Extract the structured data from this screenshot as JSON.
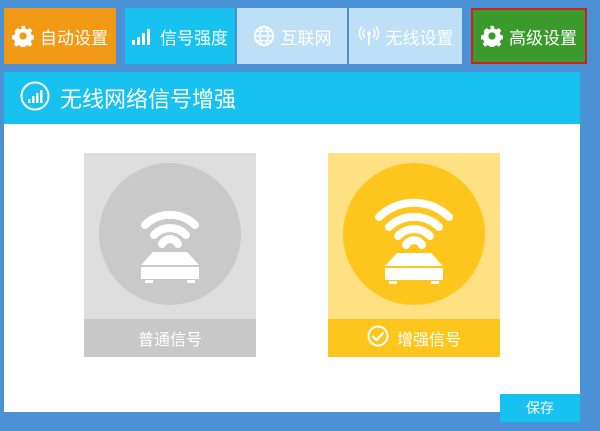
{
  "nav": {
    "tabs": [
      {
        "label": "自动设置",
        "icon": "gear-icon"
      },
      {
        "label": "信号强度",
        "icon": "signal-bars-icon"
      },
      {
        "label": "互联网",
        "icon": "globe-icon"
      },
      {
        "label": "无线设置",
        "icon": "antenna-icon"
      },
      {
        "label": "高级设置",
        "icon": "gear-icon"
      }
    ]
  },
  "panel": {
    "title": "无线网络信号增强",
    "title_icon": "signal-bars-circle-icon"
  },
  "options": [
    {
      "label": "普通信号",
      "selected": false,
      "icon": "router-wifi-icon"
    },
    {
      "label": "增强信号",
      "selected": true,
      "icon": "router-wifi-icon"
    }
  ],
  "footer": {
    "save_label": "保存"
  },
  "colors": {
    "background": "#4a91d6",
    "accent_cyan": "#17c1f0",
    "orange": "#f29a16",
    "green": "#3a9b2c",
    "highlight_border": "#d3201e",
    "yellow": "#fec61d"
  }
}
